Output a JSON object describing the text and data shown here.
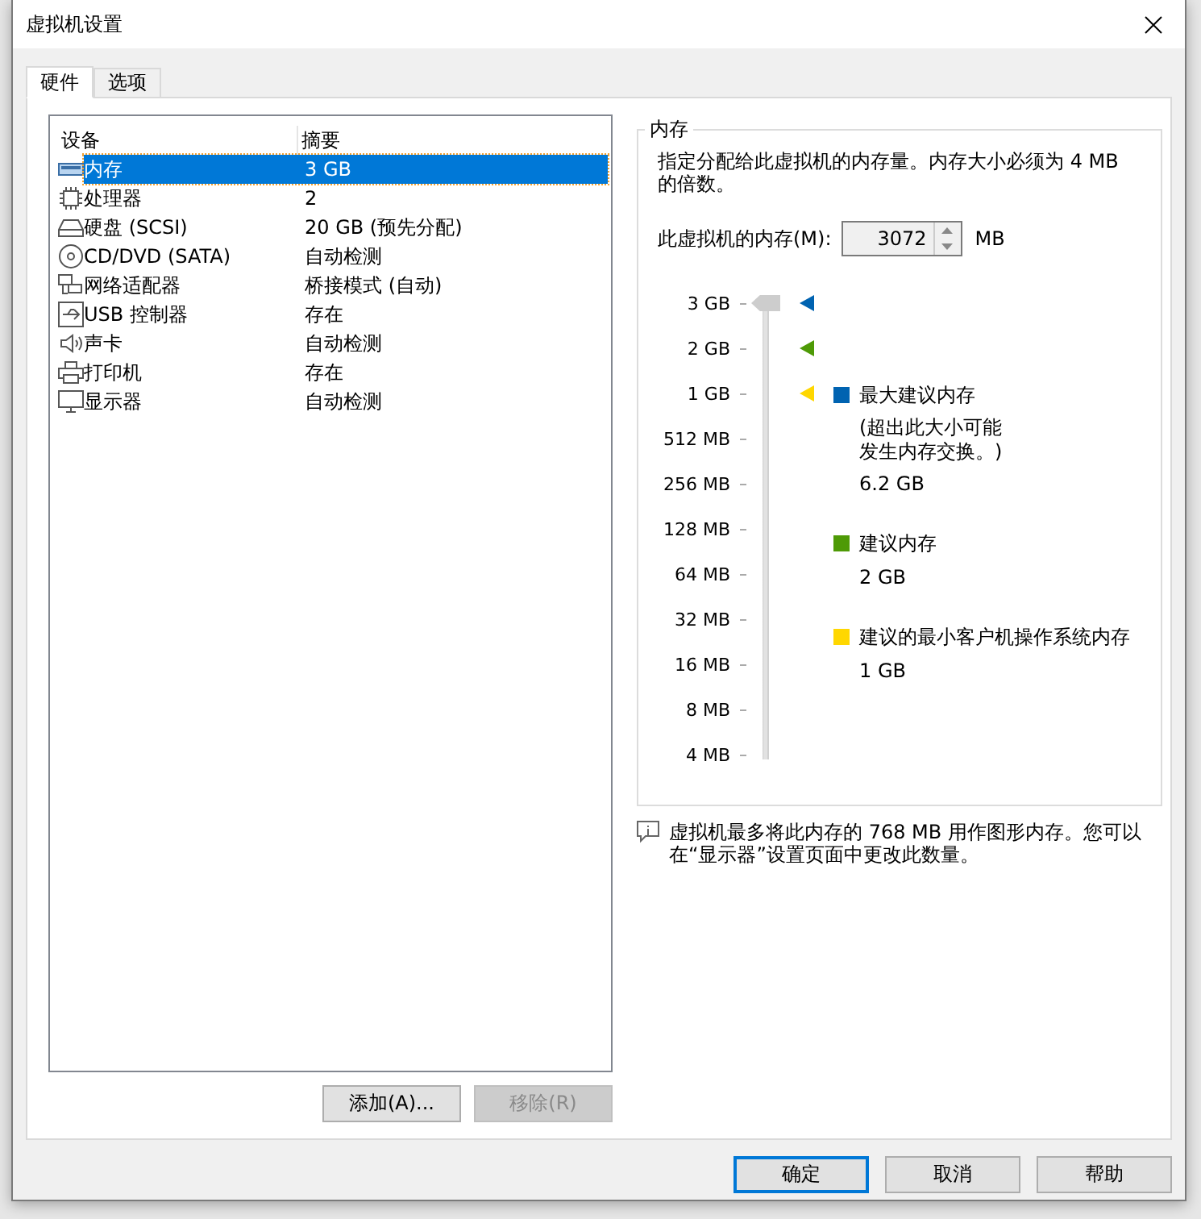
{
  "window": {
    "title": "虚拟机设置"
  },
  "tabs": [
    {
      "label": "硬件",
      "selected": true
    },
    {
      "label": "选项",
      "selected": false
    }
  ],
  "devices": {
    "columns": [
      "设备",
      "摘要"
    ],
    "rows": [
      {
        "kind": "memory",
        "name": "内存",
        "summary": "3 GB",
        "selected": true
      },
      {
        "kind": "cpu",
        "name": "处理器",
        "summary": "2",
        "selected": false
      },
      {
        "kind": "disk",
        "name": "硬盘 (SCSI)",
        "summary": "20 GB (预先分配)",
        "selected": false
      },
      {
        "kind": "cdrom",
        "name": "CD/DVD (SATA)",
        "summary": "自动检测",
        "selected": false
      },
      {
        "kind": "network",
        "name": "网络适配器",
        "summary": "桥接模式 (自动)",
        "selected": false
      },
      {
        "kind": "usb",
        "name": "USB 控制器",
        "summary": "存在",
        "selected": false
      },
      {
        "kind": "sound",
        "name": "声卡",
        "summary": "自动检测",
        "selected": false
      },
      {
        "kind": "printer",
        "name": "打印机",
        "summary": "存在",
        "selected": false
      },
      {
        "kind": "display",
        "name": "显示器",
        "summary": "自动检测",
        "selected": false
      }
    ]
  },
  "device_buttons": [
    {
      "label": "添加(A)...",
      "disabled": false
    },
    {
      "label": "移除(R)",
      "disabled": true
    }
  ],
  "memory": {
    "title": "内存",
    "description": "指定分配给此虚拟机的内存量。内存大小必须为 4 MB 的倍数。",
    "field_label": "此虚拟机的内存(M):",
    "value": "3072",
    "unit": "MB",
    "slider": {
      "level": 1
    },
    "scale": [
      {
        "label": "3 GB",
        "color": "#0063b1"
      },
      {
        "label": "2 GB",
        "color": "#4e9a06"
      },
      {
        "label": "1 GB",
        "color": "#ffd700"
      },
      {
        "label": "512 MB"
      },
      {
        "label": "256 MB"
      },
      {
        "label": "128 MB"
      },
      {
        "label": "64 MB"
      },
      {
        "label": "32 MB"
      },
      {
        "label": "16 MB"
      },
      {
        "label": "8 MB"
      },
      {
        "label": "4 MB"
      }
    ],
    "legend": [
      {
        "color": "#0063b1",
        "title": "最大建议内存",
        "note": "(超出此大小可能发生内存交换。)",
        "value": "6.2 GB"
      },
      {
        "color": "#4e9a06",
        "title": "建议内存",
        "value": "2 GB"
      },
      {
        "color": "#ffd700",
        "title": "建议的最小客户机操作系统内存",
        "value": "1 GB"
      }
    ],
    "info": "虚拟机最多将此内存的 768 MB 用作图形内存。您可以在“显示器”设置页面中更改此数量。"
  },
  "dialog_buttons": [
    {
      "label": "确定",
      "default": true
    },
    {
      "label": "取消",
      "default": false
    },
    {
      "label": "帮助",
      "default": false
    }
  ]
}
